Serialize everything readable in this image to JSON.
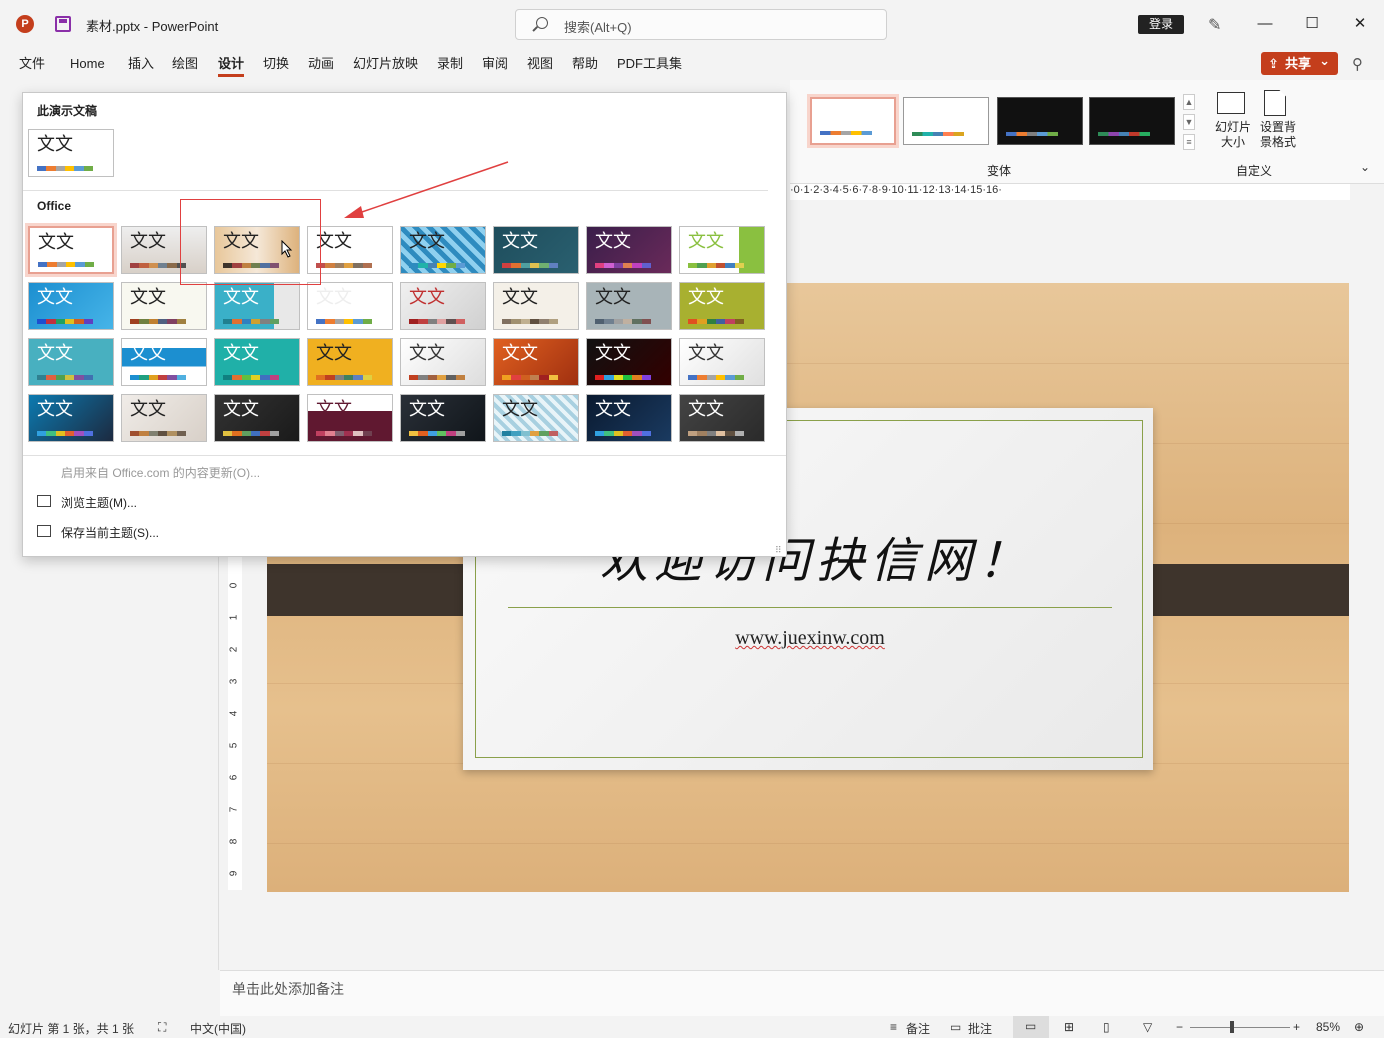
{
  "titlebar": {
    "app_icon": "P",
    "doc_title": "素材.pptx  -  PowerPoint",
    "search_placeholder": "搜索(Alt+Q)",
    "login": "登录",
    "minimize": "—",
    "maximize": "☐",
    "close": "✕"
  },
  "menu": [
    "文件",
    "Home",
    "插入",
    "绘图",
    "设计",
    "切换",
    "动画",
    "幻灯片放映",
    "录制",
    "审阅",
    "视图",
    "帮助",
    "PDF工具集"
  ],
  "menu_active": "设计",
  "share": "共享",
  "ribbon": {
    "variant_label": "变体",
    "slide_size": "幻灯片\n大小",
    "bg_format": "设置背\n景格式",
    "custom_label": "自定义",
    "collapse": "⌄"
  },
  "ruler_h": "·0·1·2·3·4·5·6·7·8·9·10·11·12·13·14·15·16·",
  "ruler_v": [
    "0",
    "1",
    "2",
    "3",
    "4",
    "5",
    "6",
    "7",
    "8",
    "9"
  ],
  "dropdown": {
    "this_presentation": "此演示文稿",
    "office": "Office",
    "thumb_text": "文文",
    "enable_updates": "启用来自 Office.com 的内容更新(O)...",
    "browse": "浏览主题(M)...",
    "save_theme": "保存当前主题(S)...",
    "grip": "⠿"
  },
  "slide": {
    "title": "欢迎访问抉信网！",
    "url": "www.juexinw.com"
  },
  "notes_placeholder": "单击此处添加备注",
  "status": {
    "slide_info": "幻灯片 第 1 张，共 1 张",
    "language": "中文(中国)",
    "notes": "备注",
    "comments": "批注",
    "zoom": "85%"
  },
  "colors": {
    "accent": "#c43e1c",
    "annotation": "#e04040"
  }
}
